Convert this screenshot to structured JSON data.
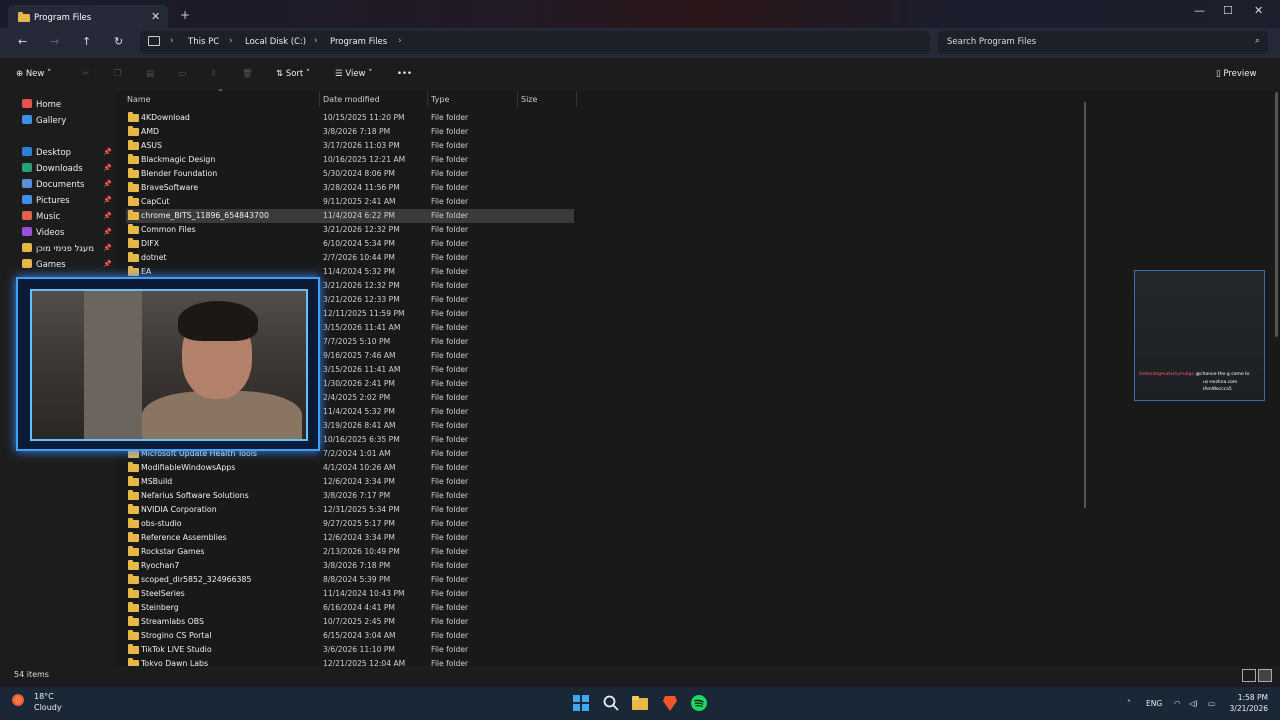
{
  "window": {
    "tab_title": "Program Files",
    "tab_close": "✕",
    "new_tab": "+",
    "minimize": "—",
    "maximize": "☐",
    "close": "✕"
  },
  "address": {
    "crumbs": [
      "This PC",
      "Local Disk (C:)",
      "Program Files"
    ],
    "search_placeholder": "Search Program Files"
  },
  "toolbar": {
    "new_label": "New",
    "sort_label": "Sort",
    "view_label": "View",
    "more_label": "•••",
    "preview_label": "Preview"
  },
  "sidebar": {
    "items": [
      {
        "label": "Home",
        "icon": "home-icon",
        "color": "#e5554e"
      },
      {
        "label": "Gallery",
        "icon": "gallery-icon",
        "color": "#3f8fe0"
      },
      {
        "label": "Desktop",
        "icon": "desktop-icon",
        "color": "#2f7fd6",
        "pinned": true
      },
      {
        "label": "Downloads",
        "icon": "downloads-icon",
        "color": "#2a9d7a",
        "pinned": true
      },
      {
        "label": "Documents",
        "icon": "documents-icon",
        "color": "#5d8fd8",
        "pinned": true
      },
      {
        "label": "Pictures",
        "icon": "pictures-icon",
        "color": "#3d8fe8",
        "pinned": true
      },
      {
        "label": "Music",
        "icon": "music-icon",
        "color": "#e0624e",
        "pinned": true
      },
      {
        "label": "Videos",
        "icon": "videos-icon",
        "color": "#9b4fd6",
        "pinned": true
      },
      {
        "label": "מעגל פנימי מוכן",
        "icon": "folder-icon",
        "color": "#e6b84a",
        "pinned": true
      },
      {
        "label": "Games",
        "icon": "folder-icon",
        "color": "#e6b84a",
        "pinned": true
      }
    ]
  },
  "columns": {
    "name": "Name",
    "date": "Date modified",
    "type": "Type",
    "size": "Size"
  },
  "files": [
    {
      "name": "4KDownload",
      "date": "10/15/2025 11:20 PM",
      "type": "File folder"
    },
    {
      "name": "AMD",
      "date": "3/8/2026 7:18 PM",
      "type": "File folder"
    },
    {
      "name": "ASUS",
      "date": "3/17/2026 11:03 PM",
      "type": "File folder"
    },
    {
      "name": "Blackmagic Design",
      "date": "10/16/2025 12:21 AM",
      "type": "File folder"
    },
    {
      "name": "Blender Foundation",
      "date": "5/30/2024 8:06 PM",
      "type": "File folder"
    },
    {
      "name": "BraveSoftware",
      "date": "3/28/2024 11:56 PM",
      "type": "File folder"
    },
    {
      "name": "CapCut",
      "date": "9/11/2025 2:41 AM",
      "type": "File folder"
    },
    {
      "name": "chrome_BITS_11896_654843700",
      "date": "11/4/2024 6:22 PM",
      "type": "File folder",
      "selected": true
    },
    {
      "name": "Common Files",
      "date": "3/21/2026 12:32 PM",
      "type": "File folder"
    },
    {
      "name": "DIFX",
      "date": "6/10/2024 5:34 PM",
      "type": "File folder"
    },
    {
      "name": "dotnet",
      "date": "2/7/2026 10:44 PM",
      "type": "File folder"
    },
    {
      "name": "EA",
      "date": "11/4/2024 5:32 PM",
      "type": "File folder"
    },
    {
      "name": "",
      "date": "3/21/2026 12:32 PM",
      "type": "File folder"
    },
    {
      "name": "",
      "date": "3/21/2026 12:33 PM",
      "type": "File folder"
    },
    {
      "name": "",
      "date": "12/11/2025 11:59 PM",
      "type": "File folder"
    },
    {
      "name": "",
      "date": "3/15/2026 11:41 AM",
      "type": "File folder"
    },
    {
      "name": "",
      "date": "7/7/2025 5:10 PM",
      "type": "File folder"
    },
    {
      "name": "",
      "date": "9/16/2025 7:46 AM",
      "type": "File folder"
    },
    {
      "name": "",
      "date": "3/15/2026 11:41 AM",
      "type": "File folder"
    },
    {
      "name": "",
      "date": "1/30/2026 2:41 PM",
      "type": "File folder"
    },
    {
      "name": "",
      "date": "2/4/2025 2:02 PM",
      "type": "File folder"
    },
    {
      "name": "",
      "date": "11/4/2024 5:32 PM",
      "type": "File folder"
    },
    {
      "name": "",
      "date": "3/19/2026 8:41 AM",
      "type": "File folder"
    },
    {
      "name": "",
      "date": "10/16/2025 6:35 PM",
      "type": "File folder"
    },
    {
      "name": "Microsoft Update Health Tools",
      "date": "7/2/2024 1:01 AM",
      "type": "File folder"
    },
    {
      "name": "ModifiableWindowsApps",
      "date": "4/1/2024 10:26 AM",
      "type": "File folder"
    },
    {
      "name": "MSBuild",
      "date": "12/6/2024 3:34 PM",
      "type": "File folder"
    },
    {
      "name": "Nefarius Software Solutions",
      "date": "3/8/2026 7:17 PM",
      "type": "File folder"
    },
    {
      "name": "NVIDIA Corporation",
      "date": "12/31/2025 5:34 PM",
      "type": "File folder"
    },
    {
      "name": "obs-studio",
      "date": "9/27/2025 5:17 PM",
      "type": "File folder"
    },
    {
      "name": "Reference Assemblies",
      "date": "12/6/2024 3:34 PM",
      "type": "File folder"
    },
    {
      "name": "Rockstar Games",
      "date": "2/13/2026 10:49 PM",
      "type": "File folder"
    },
    {
      "name": "Ryochan7",
      "date": "3/8/2026 7:18 PM",
      "type": "File folder"
    },
    {
      "name": "scoped_dir5852_324966385",
      "date": "8/8/2024 5:39 PM",
      "type": "File folder"
    },
    {
      "name": "SteelSeries",
      "date": "11/14/2024 10:43 PM",
      "type": "File folder"
    },
    {
      "name": "Steinberg",
      "date": "6/16/2024 4:41 PM",
      "type": "File folder"
    },
    {
      "name": "Streamlabs OBS",
      "date": "10/7/2025 2:45 PM",
      "type": "File folder"
    },
    {
      "name": "Strogino CS Portal",
      "date": "6/15/2024 3:04 AM",
      "type": "File folder"
    },
    {
      "name": "TikTok LIVE Studio",
      "date": "3/6/2026 11:10 PM",
      "type": "File folder"
    },
    {
      "name": "Tokyo Dawn Labs",
      "date": "12/21/2025 12:04 AM",
      "type": "File folder"
    }
  ],
  "status": {
    "item_count": "54 items"
  },
  "overlay_text": {
    "red": "botterdegreatomyhubgo",
    "white": "@chance-the-g come to",
    "line2": "us-nezhna.com",
    "line3": "iAmWeccca5"
  },
  "taskbar": {
    "temp": "18°C",
    "condition": "Cloudy",
    "lang": "ENG",
    "time": "1:58 PM",
    "date": "3/21/2026"
  }
}
